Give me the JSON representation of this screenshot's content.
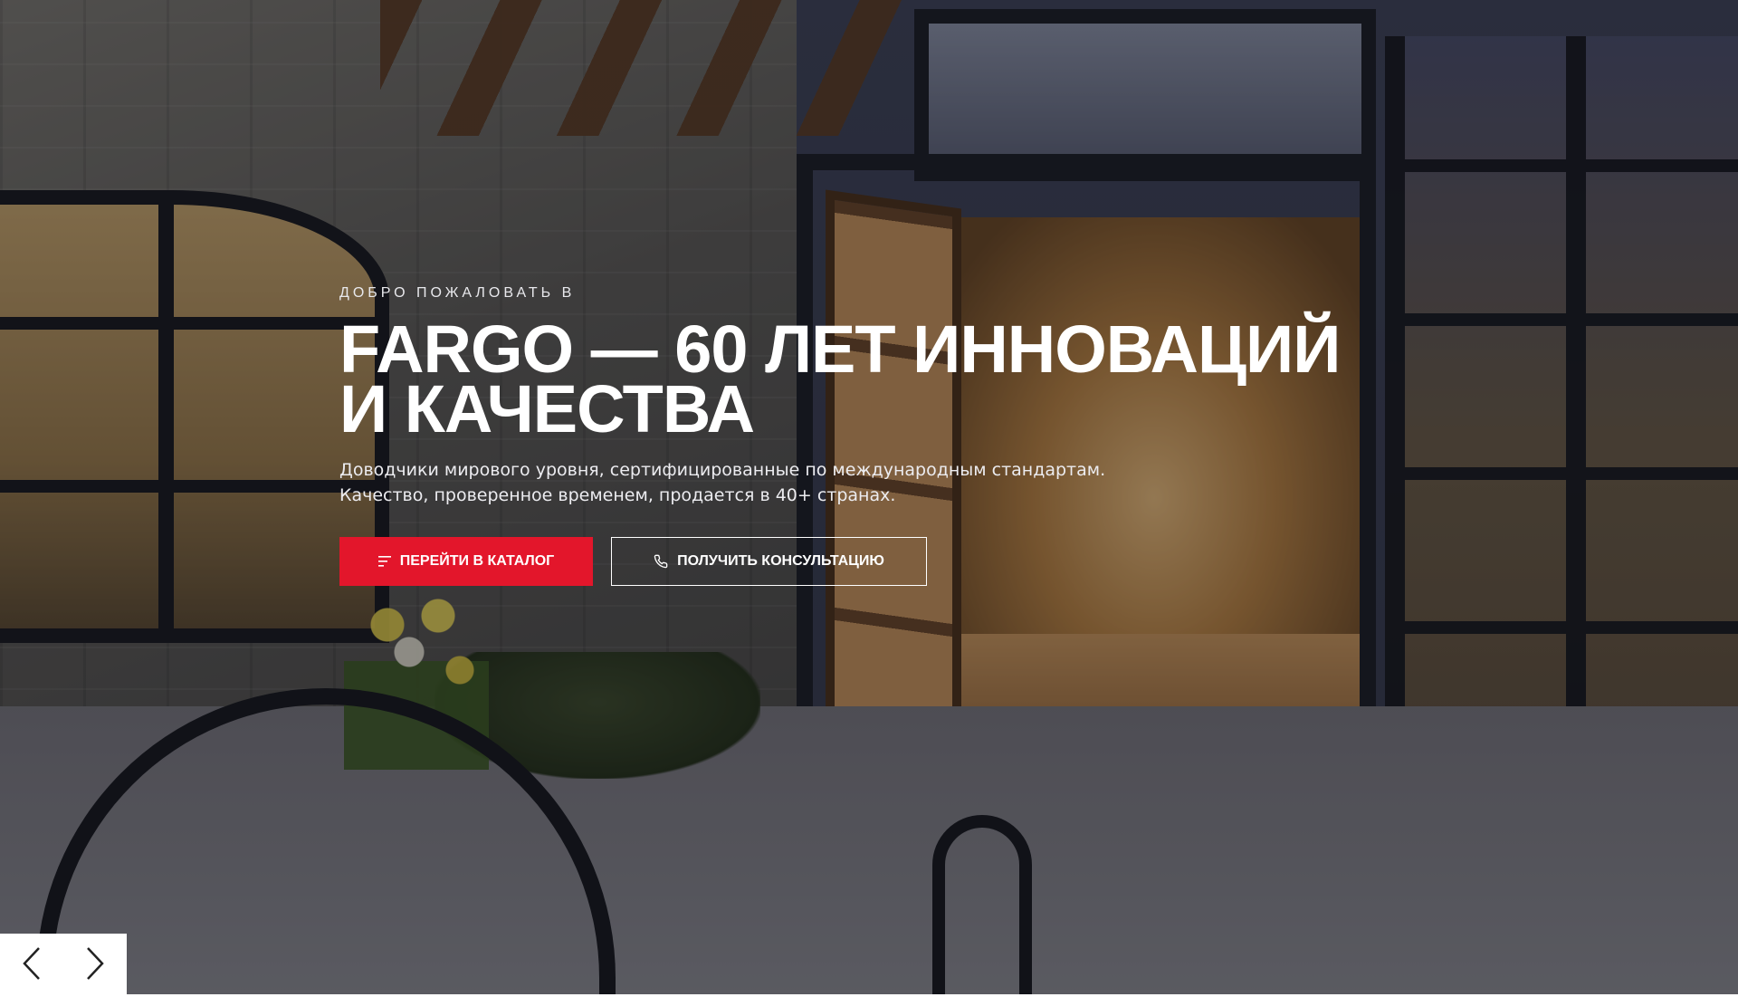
{
  "hero": {
    "eyebrow": "ДОБРО ПОЖАЛОВАТЬ В",
    "headline_line1": "FARGO — 60 ЛЕТ ИННОВАЦИЙ",
    "headline_line2": "И КАЧЕСТВА",
    "subtext_line1": "Доводчики мирового уровня, сертифицированные по международным стандартам.",
    "subtext_line2": "Качество, проверенное временем, продается в 40+ странах."
  },
  "buttons": {
    "catalog_label": "ПЕРЕЙТИ В КАТАЛОГ",
    "catalog_icon": "menu-lines-icon",
    "consult_label": "ПОЛУЧИТЬ КОНСУЛЬТАЦИЮ",
    "consult_icon": "phone-icon"
  },
  "slider": {
    "prev_icon": "chevron-left-icon",
    "next_icon": "chevron-right-icon"
  },
  "colors": {
    "accent": "#e3162b",
    "text": "#ffffff"
  }
}
